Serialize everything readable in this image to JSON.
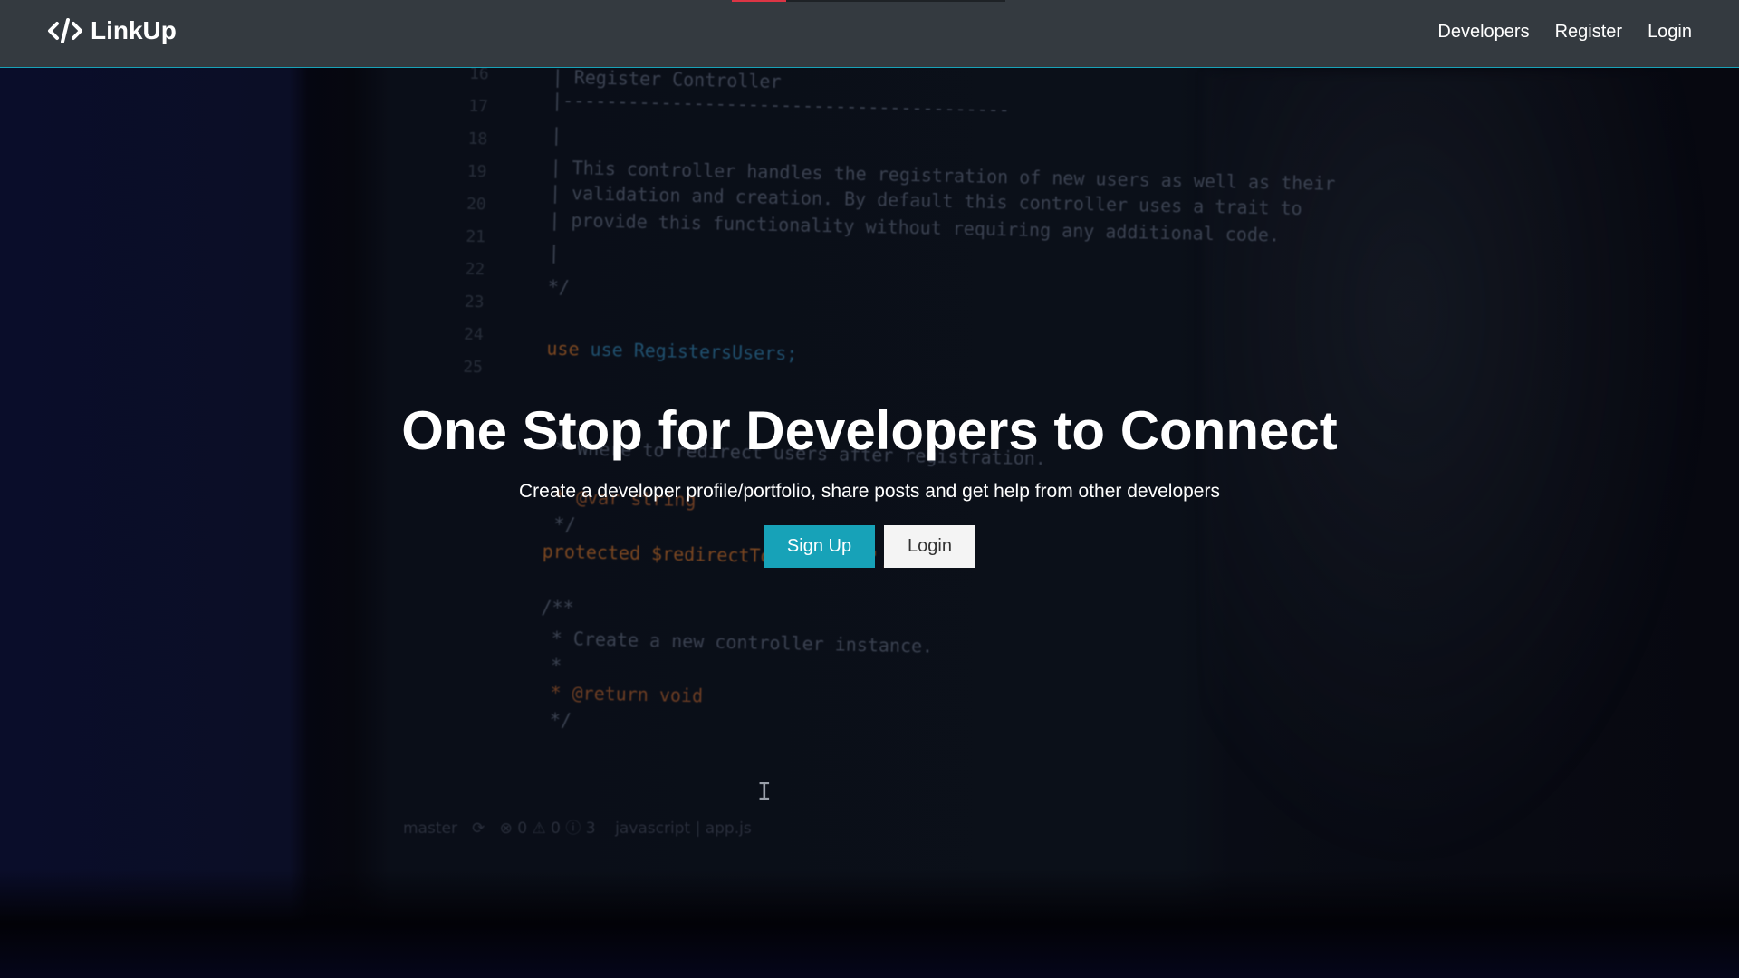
{
  "navbar": {
    "brand": "LinkUp",
    "brand_icon": "code-icon",
    "links": [
      "Developers",
      "Register",
      "Login"
    ]
  },
  "hero": {
    "title": "One Stop for Developers to Connect",
    "subtitle": "Create a developer profile/portfolio, share posts and get help from other developers",
    "signup_label": "Sign Up",
    "login_label": "Login"
  },
  "background_code": {
    "line_numbers": [
      "16",
      "17",
      "18",
      "19",
      "20",
      "21",
      "22",
      "23",
      "24",
      "25",
      "",
      "",
      "",
      "",
      "",
      "",
      "",
      "",
      "",
      "",
      "",
      "",
      "",
      ""
    ],
    "lines": [
      "| Register Controller",
      "|-----------------------------------------",
      "|",
      "| This controller handles the registration of new users as well as their",
      "| validation and creation. By default this controller uses a trait to",
      "| provide this functionality without requiring any additional code.",
      "|",
      "*/",
      "",
      "use RegistersUsers;",
      "",
      "",
      "",
      " * Where to redirect users after registration.",
      "",
      " * @var string",
      " */",
      "protected $redirectTo = '/home';",
      "",
      "/**",
      " * Create a new controller instance.",
      " *",
      " * @return void",
      " */"
    ],
    "status_bar": "master   ⟳   ⊗ 0 ⚠ 0 ⓘ 3    javascript | app.js"
  },
  "colors": {
    "navbar_bg": "#343a40",
    "accent": "#17a2b8",
    "light_button": "#f4f4f4"
  }
}
